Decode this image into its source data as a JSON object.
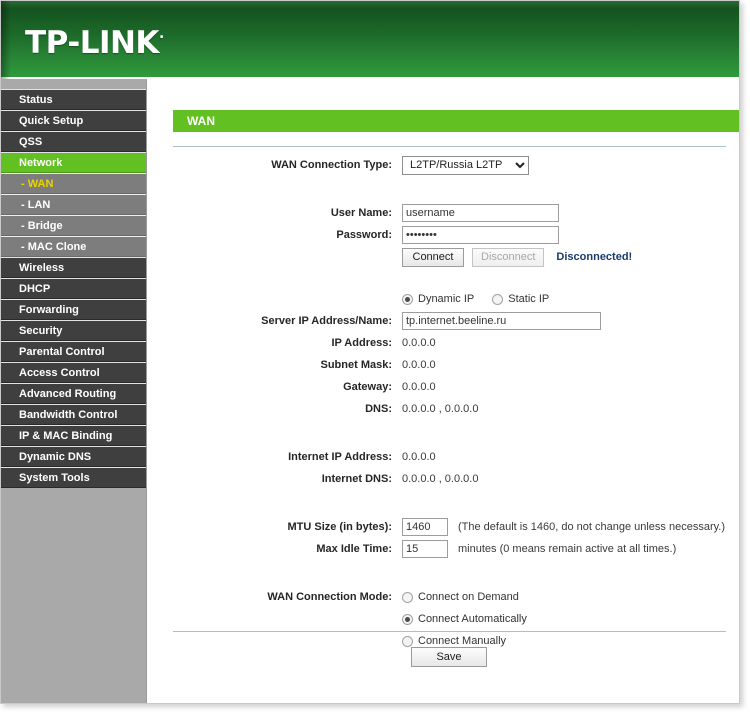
{
  "brand": {
    "logo_text": "TP-LINK",
    "logo_mark": "·",
    "header_color": "#1d6b2a",
    "accent_green": "#62c022"
  },
  "sidebar": {
    "items": [
      {
        "label": "Status",
        "type": "main",
        "state": "normal"
      },
      {
        "label": "Quick Setup",
        "type": "main",
        "state": "normal"
      },
      {
        "label": "QSS",
        "type": "main",
        "state": "normal"
      },
      {
        "label": "Network",
        "type": "main",
        "state": "active"
      },
      {
        "label": "- WAN",
        "type": "sub",
        "state": "current"
      },
      {
        "label": "- LAN",
        "type": "sub",
        "state": "normal"
      },
      {
        "label": "- Bridge",
        "type": "sub",
        "state": "normal"
      },
      {
        "label": "- MAC Clone",
        "type": "sub",
        "state": "normal"
      },
      {
        "label": "Wireless",
        "type": "main",
        "state": "normal"
      },
      {
        "label": "DHCP",
        "type": "main",
        "state": "normal"
      },
      {
        "label": "Forwarding",
        "type": "main",
        "state": "normal"
      },
      {
        "label": "Security",
        "type": "main",
        "state": "normal"
      },
      {
        "label": "Parental Control",
        "type": "main",
        "state": "normal"
      },
      {
        "label": "Access Control",
        "type": "main",
        "state": "normal"
      },
      {
        "label": "Advanced Routing",
        "type": "main",
        "state": "normal"
      },
      {
        "label": "Bandwidth Control",
        "type": "main",
        "state": "normal"
      },
      {
        "label": "IP & MAC Binding",
        "type": "main",
        "state": "normal"
      },
      {
        "label": "Dynamic DNS",
        "type": "main",
        "state": "normal"
      },
      {
        "label": "System Tools",
        "type": "main",
        "state": "normal"
      }
    ]
  },
  "page": {
    "banner_title": "WAN"
  },
  "form": {
    "connection_type": {
      "label": "WAN Connection Type:",
      "value": "L2TP/Russia L2TP"
    },
    "user_name": {
      "label": "User Name:",
      "value": "username"
    },
    "password": {
      "label": "Password:",
      "value": "••••••••"
    },
    "connect_button": "Connect",
    "disconnect_button": "Disconnect",
    "status": "Disconnected!",
    "addr_mode": {
      "dynamic": "Dynamic IP",
      "static": "Static IP",
      "selected": "Dynamic IP"
    },
    "server": {
      "label": "Server IP Address/Name:",
      "value": "tp.internet.beeline.ru"
    },
    "ip_address": {
      "label": "IP Address:",
      "value": "0.0.0.0"
    },
    "subnet_mask": {
      "label": "Subnet Mask:",
      "value": "0.0.0.0"
    },
    "gateway": {
      "label": "Gateway:",
      "value": "0.0.0.0"
    },
    "dns": {
      "label": "DNS:",
      "value": "0.0.0.0 , 0.0.0.0"
    },
    "internet_ip": {
      "label": "Internet IP Address:",
      "value": "0.0.0.0"
    },
    "internet_dns": {
      "label": "Internet DNS:",
      "value": "0.0.0.0 , 0.0.0.0"
    },
    "mtu": {
      "label": "MTU Size (in bytes):",
      "value": "1460",
      "hint": "(The default is 1460, do not change unless necessary.)"
    },
    "max_idle": {
      "label": "Max Idle Time:",
      "value": "15",
      "hint": "minutes (0 means remain active at all times.)"
    },
    "connection_mode": {
      "label": "WAN Connection Mode:",
      "options": [
        "Connect on Demand",
        "Connect Automatically",
        "Connect Manually"
      ],
      "selected": "Connect Automatically"
    },
    "save_button": "Save"
  }
}
